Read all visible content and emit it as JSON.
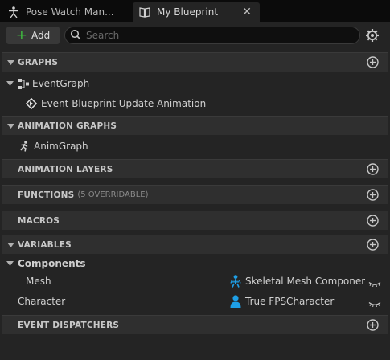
{
  "tabs": [
    {
      "label": "Pose Watch Man...",
      "icon": "pose-figure-icon"
    },
    {
      "label": "My Blueprint",
      "icon": "book-icon",
      "close": "✕"
    }
  ],
  "toolbar": {
    "add_label": "Add",
    "search_placeholder": "Search",
    "search_value": ""
  },
  "sections": {
    "graphs": {
      "title": "GRAPHS"
    },
    "animation_graphs": {
      "title": "ANIMATION GRAPHS"
    },
    "animation_layers": {
      "title": "ANIMATION LAYERS"
    },
    "functions": {
      "title": "FUNCTIONS",
      "subtitle": "(5 OVERRIDABLE)"
    },
    "macros": {
      "title": "MACROS"
    },
    "variables": {
      "title": "VARIABLES"
    },
    "event_dispatchers": {
      "title": "EVENT DISPATCHERS"
    }
  },
  "graphs": {
    "event_graph": {
      "label": "EventGraph",
      "icon": "graph-nodes-icon"
    },
    "event_blueprint_update": {
      "label": "Event Blueprint Update Animation",
      "icon": "event-diamond-icon"
    }
  },
  "animation_graphs": {
    "anim_graph": {
      "label": "AnimGraph",
      "icon": "running-figure-icon"
    }
  },
  "variables": {
    "components_label": "Components",
    "items": [
      {
        "name": "Mesh",
        "type": "Skeletal Mesh Componen",
        "type_icon": "skeleton-icon"
      },
      {
        "name": "Character",
        "type": "True FPSCharacter",
        "type_icon": "person-icon"
      }
    ]
  },
  "colors": {
    "accent_green": "#3fbf3f",
    "variable_blue": "#1e9fe6",
    "panel_bg": "#242424",
    "section_bg": "#2f2f2f"
  }
}
